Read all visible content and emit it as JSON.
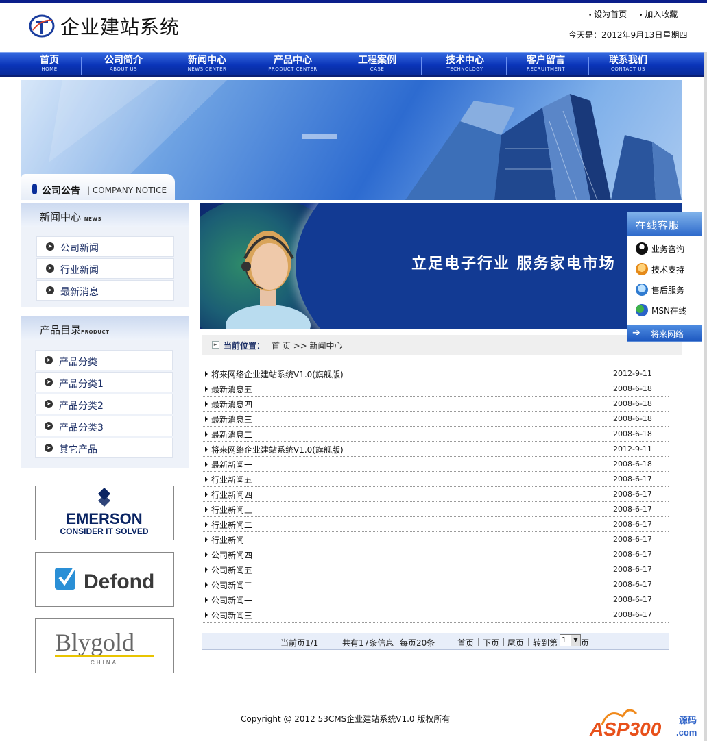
{
  "header": {
    "site_title": "企业建站系统",
    "links": [
      "设为首页",
      "加入收藏"
    ],
    "today": "今天是：2012年9月13日星期四"
  },
  "nav": [
    {
      "cn": "首页",
      "en": "HOME"
    },
    {
      "cn": "公司简介",
      "en": "ABOUT US"
    },
    {
      "cn": "新闻中心",
      "en": "NEWS CENTER"
    },
    {
      "cn": "产品中心",
      "en": "PRODUCT CENTER"
    },
    {
      "cn": "工程案例",
      "en": "CASE"
    },
    {
      "cn": "技术中心",
      "en": "TECHNOLOGY"
    },
    {
      "cn": "客户留言",
      "en": "RECRUITMENT"
    },
    {
      "cn": "联系我们",
      "en": "CONTACT US"
    }
  ],
  "notice": {
    "cn": "公司公告",
    "en": "| COMPANY NOTICE"
  },
  "news_box": {
    "title": "新闻中心",
    "title_en": "NEWS",
    "items": [
      "公司新闻",
      "行业新闻",
      "最新消息"
    ]
  },
  "product_box": {
    "title": "产品目录",
    "title_en": "PRODUCT",
    "items": [
      "产品分类",
      "产品分类1",
      "产品分类2",
      "产品分类3",
      "其它产品"
    ]
  },
  "brands": [
    {
      "name": "EMERSON",
      "tagline": "CONSIDER IT SOLVED"
    },
    {
      "name": "Defond"
    },
    {
      "name": "Blygold",
      "sub": "CHINA"
    }
  ],
  "hero": {
    "slogan": "立足电子行业 服务家电市场"
  },
  "location": {
    "label": "当前位置：",
    "path": "首 页 >> 新闻中心"
  },
  "news": [
    {
      "title": "将来网络企业建站系统V1.0(旗舰版)",
      "date": "2012-9-11"
    },
    {
      "title": "最新消息五",
      "date": "2008-6-18"
    },
    {
      "title": "最新消息四",
      "date": "2008-6-18"
    },
    {
      "title": "最新消息三",
      "date": "2008-6-18"
    },
    {
      "title": "最新消息二",
      "date": "2008-6-18"
    },
    {
      "title": "将来网络企业建站系统V1.0(旗舰版)",
      "date": "2012-9-11"
    },
    {
      "title": "最新新闻一",
      "date": "2008-6-18"
    },
    {
      "title": "行业新闻五",
      "date": "2008-6-17"
    },
    {
      "title": "行业新闻四",
      "date": "2008-6-17"
    },
    {
      "title": "行业新闻三",
      "date": "2008-6-17"
    },
    {
      "title": "行业新闻二",
      "date": "2008-6-17"
    },
    {
      "title": "行业新闻一",
      "date": "2008-6-17"
    },
    {
      "title": "公司新闻四",
      "date": "2008-6-17"
    },
    {
      "title": "公司新闻五",
      "date": "2008-6-17"
    },
    {
      "title": "公司新闻二",
      "date": "2008-6-17"
    },
    {
      "title": "公司新闻一",
      "date": "2008-6-17"
    },
    {
      "title": "公司新闻三",
      "date": "2008-6-17"
    }
  ],
  "pager": {
    "current": "当前页1/1",
    "total": "共有17条信息",
    "per_page": "每页20条",
    "first": "首页",
    "prev": "下页",
    "last": "尾页",
    "goto": "转到第",
    "page_value": "1",
    "page_suffix": "页",
    "sep": "|"
  },
  "service": {
    "title": "在线客服",
    "items": [
      "业务咨询",
      "技术支持",
      "售后服务",
      "MSN在线"
    ],
    "footer": "将来网络"
  },
  "footer": {
    "copyright": "Copyright @ 2012 53CMS企业建站系统V1.0 版权所有"
  },
  "watermark": {
    "text": "ASP300",
    "sub": "源码",
    "domain": ".com"
  },
  "colors": {
    "nav_blue": "#0a34b8",
    "accent_dark": "#0b1e8a",
    "link_navy": "#1c2f66"
  }
}
